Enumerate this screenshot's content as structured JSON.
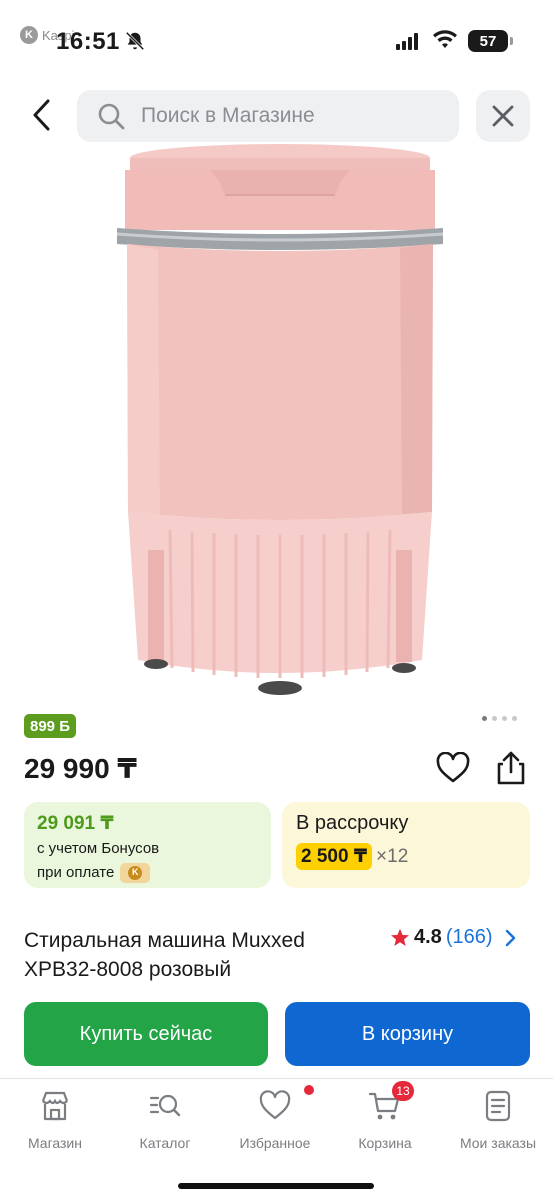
{
  "status_bar": {
    "time": "16:51",
    "carrier_label": "Kaspi",
    "carrier_badge": "K",
    "battery": "57"
  },
  "search": {
    "placeholder": "Поиск в Магазине"
  },
  "gallery": {
    "image_count": 4,
    "active_index": 0
  },
  "product": {
    "bonus_badge": "899 Б",
    "price": "29 990 ₸",
    "title": "Стиральная машина Muxxed XPB32-8008 розовый",
    "rating": "4.8",
    "reviews": "(166)"
  },
  "bonus_card": {
    "amount": "29 091 ₸",
    "line1": "с учетом Бонусов",
    "line2": "при оплате"
  },
  "installment_card": {
    "title": "В рассрочку",
    "amount": "2 500 ₸",
    "months": "×12"
  },
  "actions": {
    "buy_now": "Купить сейчас",
    "add_to_cart": "В корзину"
  },
  "bottom_nav": {
    "items": [
      {
        "label": "Магазин"
      },
      {
        "label": "Каталог"
      },
      {
        "label": "Избранное"
      },
      {
        "label": "Корзина",
        "badge": "13"
      },
      {
        "label": "Мои заказы"
      }
    ]
  },
  "colors": {
    "buy_button": "#22a447",
    "cart_button": "#0f68d1",
    "bonus_green": "#5c9c1f",
    "installment_yellow": "#ffd000",
    "badge_red": "#e5293a"
  }
}
